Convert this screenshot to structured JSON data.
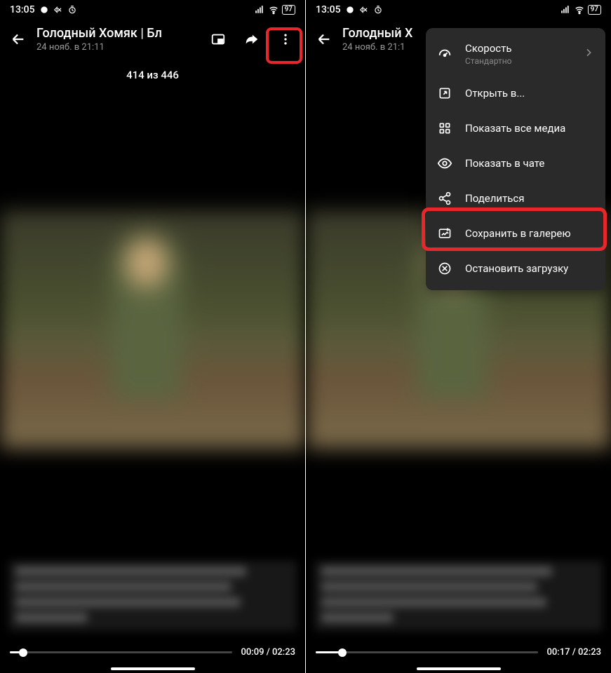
{
  "status": {
    "time": "13:05",
    "battery": "97"
  },
  "left": {
    "title": "Голодный Хомяк | Бл",
    "subtitle": "24 нояб. в 21:11",
    "counter": "414 из 446",
    "progress": {
      "current": "00:09",
      "total": "02:23",
      "pct": 6
    }
  },
  "right": {
    "title": "Голодный Х",
    "subtitle": "24 нояб. в 21:1",
    "progress": {
      "current": "00:17",
      "total": "02:23",
      "pct": 12
    }
  },
  "menu": {
    "speed_label": "Скорость",
    "speed_value": "Стандартно",
    "open_in": "Открыть в...",
    "show_all_media": "Показать все медиа",
    "show_in_chat": "Показать в чате",
    "share": "Поделиться",
    "save_gallery": "Сохранить в галерею",
    "stop_download": "Остановить загрузку"
  }
}
